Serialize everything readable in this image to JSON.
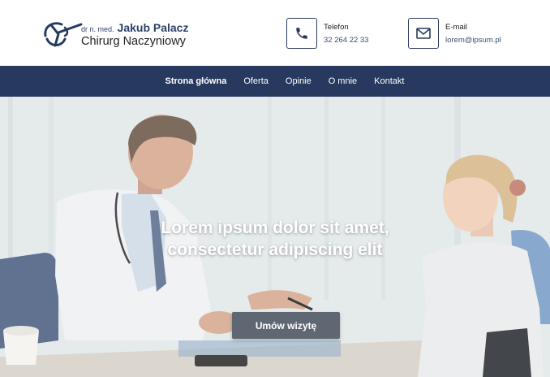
{
  "brand": {
    "prefix": "dr n. med.",
    "name": "Jakub Palacz",
    "subtitle": "Chirurg Naczyniowy"
  },
  "contacts": {
    "phone": {
      "label": "Telefon",
      "value": "32 264 22 33",
      "icon": "phone-icon"
    },
    "email": {
      "label": "E-mail",
      "value": "lorem@ipsum.pl",
      "icon": "envelope-icon"
    }
  },
  "nav": {
    "items": [
      "Strona główna",
      "Oferta",
      "Opinie",
      "O mnie",
      "Kontakt"
    ],
    "active": "Strona główna"
  },
  "hero": {
    "title_line1": "Lorem ipsum dolor sit amet,",
    "title_line2": "consectetur adipiscing elit",
    "cta": "Umów wizytę"
  },
  "colors": {
    "primary": "#27395f",
    "cta_background": "#5f6872",
    "text_dark": "#222222"
  }
}
